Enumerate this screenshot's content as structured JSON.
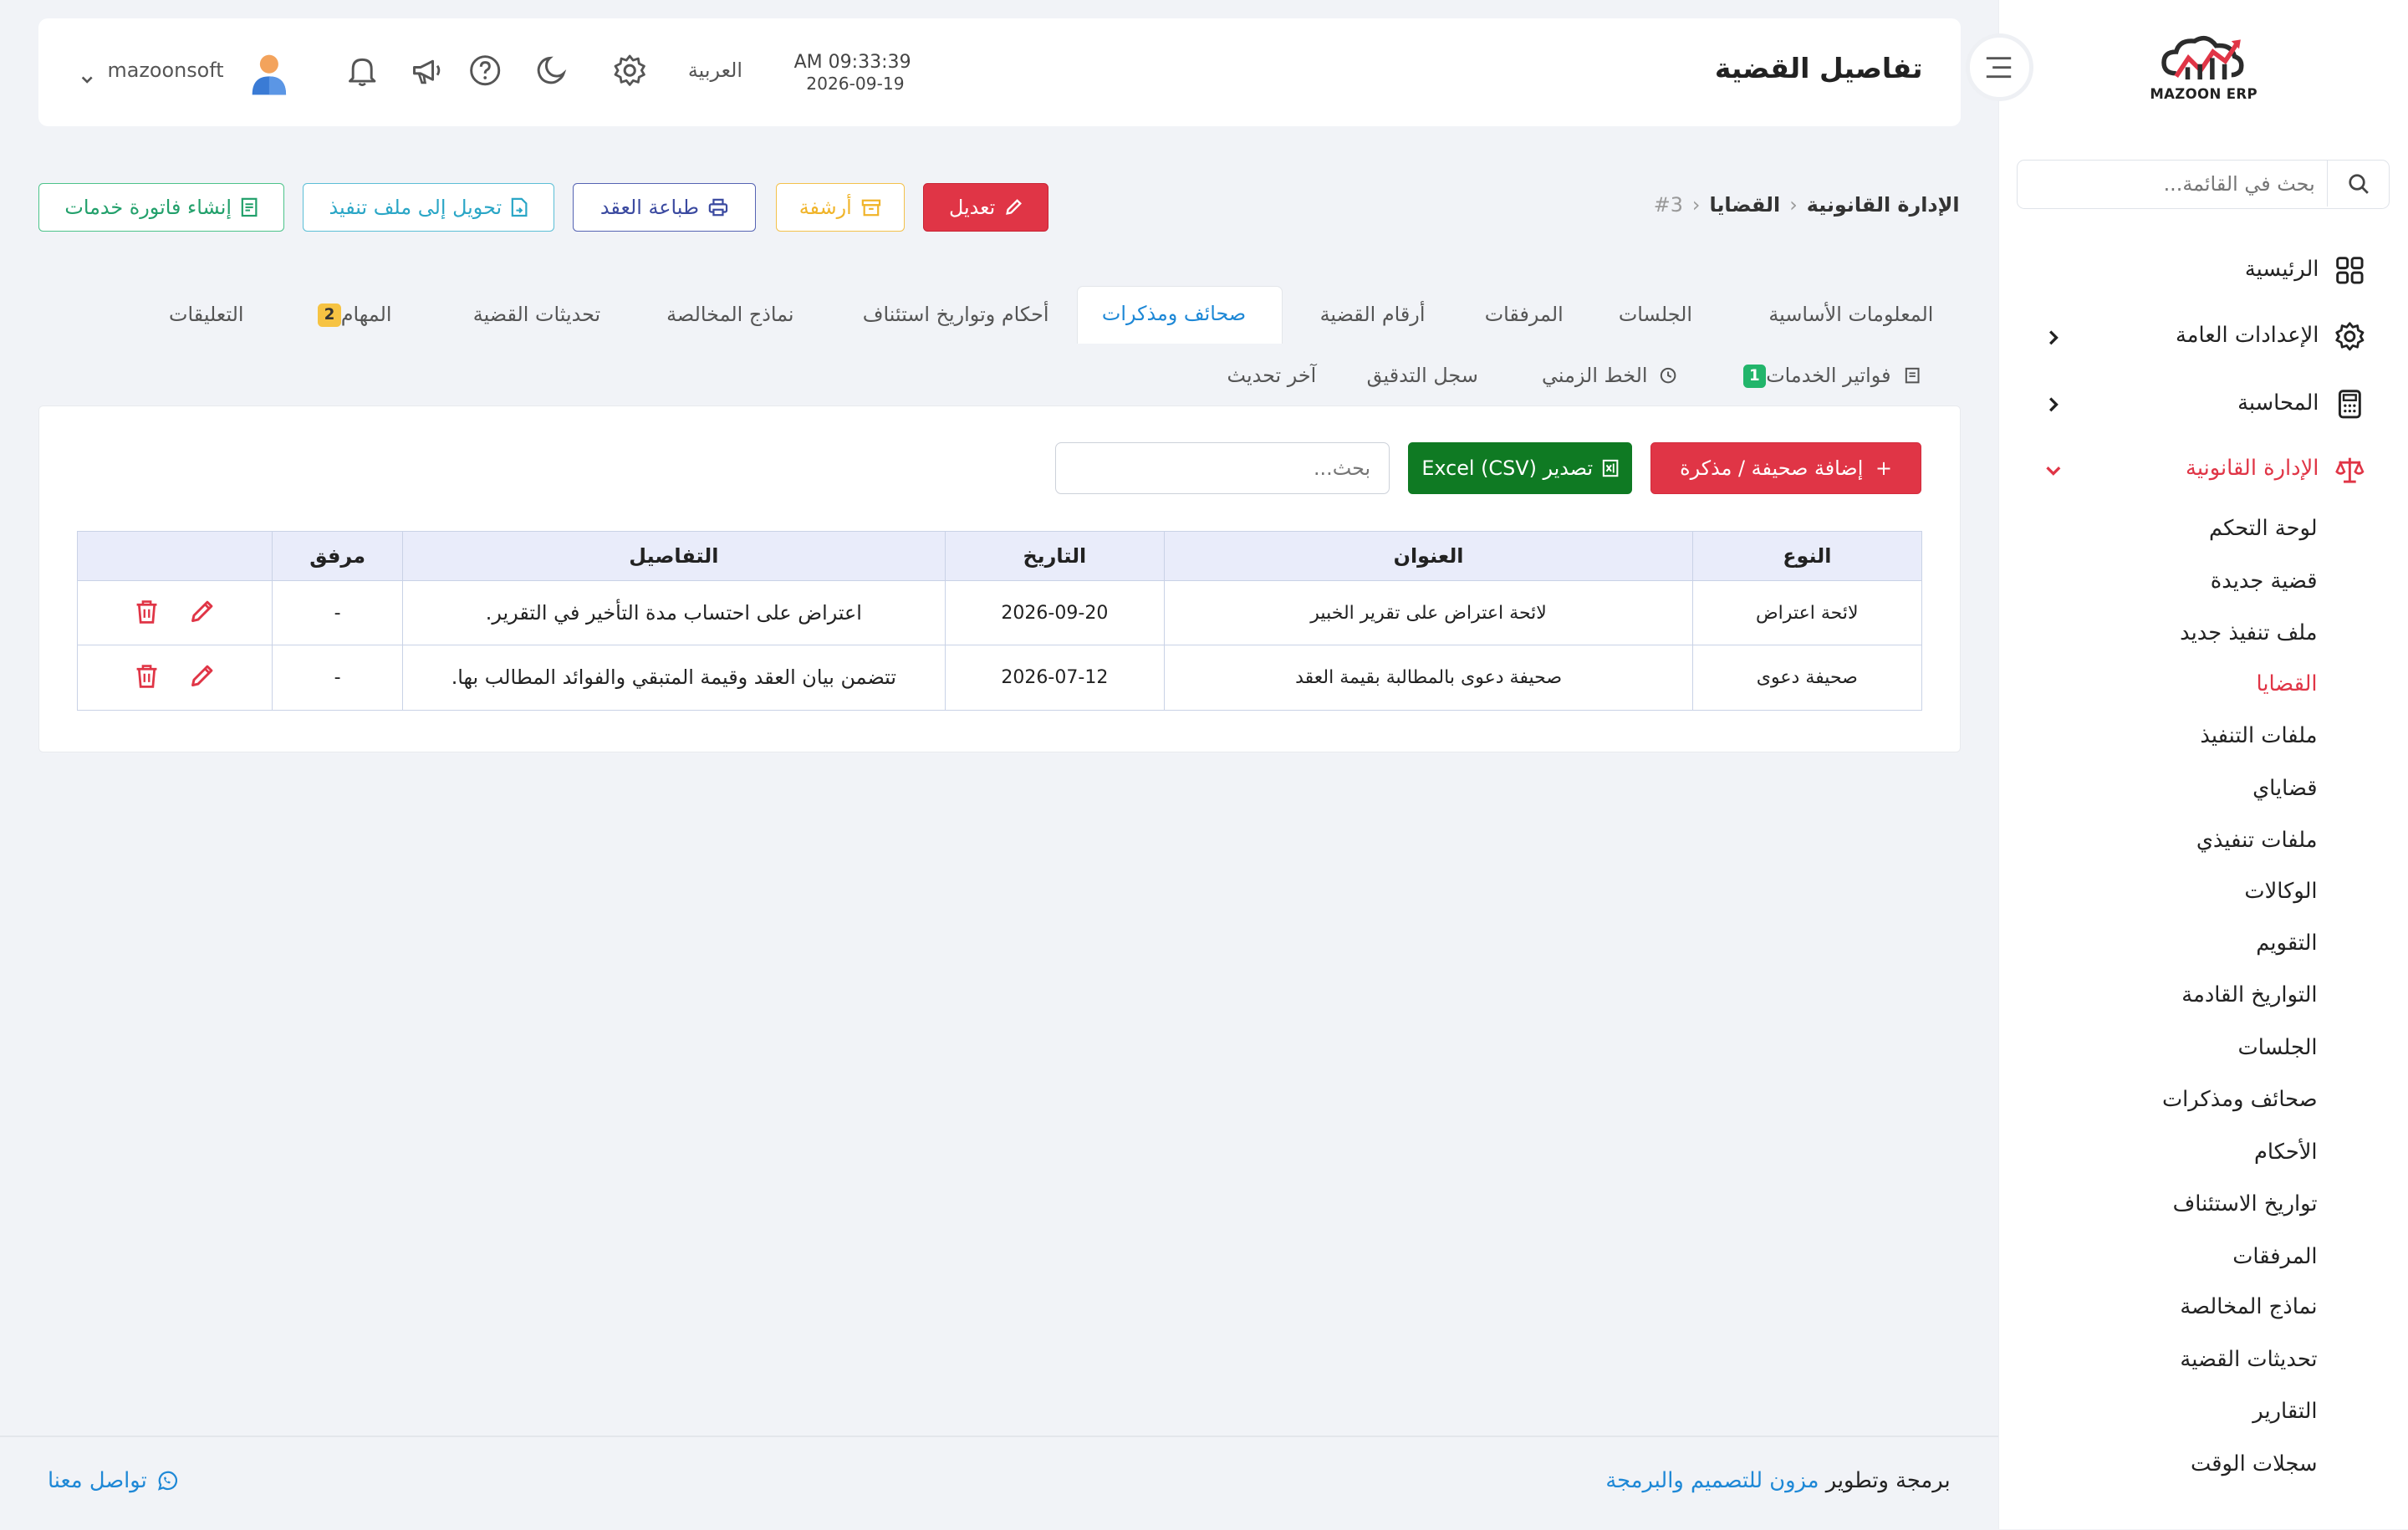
{
  "brand": {
    "logo_text": "MAZOON ERP",
    "logo_small": "ERP"
  },
  "sidebar": {
    "search_placeholder": "بحث في القائمة...",
    "items": [
      {
        "label": "الرئيسية",
        "icon": "grid-icon"
      },
      {
        "label": "الإعدادات العامة",
        "icon": "gear-icon"
      },
      {
        "label": "المحاسبة",
        "icon": "calculator-icon"
      },
      {
        "label": "الإدارة القانونية",
        "icon": "scale-icon"
      }
    ],
    "subitems": [
      "لوحة التحكم",
      "قضية جديدة",
      "ملف تنفيذ جديد",
      "القضايا",
      "ملفات التنفيذ",
      "قضاياي",
      "ملفات تنفيذي",
      "الوكالات",
      "التقويم",
      "التواريخ القادمة",
      "الجلسات",
      "صحائف ومذكرات",
      "الأحكام",
      "تواريخ الاستئناف",
      "المرفقات",
      "نماذج المخالصة",
      "تحديثات القضية",
      "التقارير",
      "سجلات الوقت"
    ]
  },
  "header": {
    "title": "تفاصيل القضية",
    "time": "AM 09:33:39",
    "date": "2026-09-19",
    "language": "العربية",
    "username": "mazoonsoft"
  },
  "breadcrumb": {
    "root": "الإدارة القانونية",
    "section": "القضايا",
    "id": "#3"
  },
  "actions": {
    "edit": "تعديل",
    "archive": "أرشفة",
    "print": "طباعة العقد",
    "convert": "تحويل إلى ملف تنفيذ",
    "invoice": "إنشاء فاتورة خدمات"
  },
  "tabs": {
    "basic": "المعلومات الأساسية",
    "sessions": "الجلسات",
    "attachments": "المرفقات",
    "case_numbers": "أرقام القضية",
    "pleadings": "صحائف ومذكرات",
    "rulings": "أحكام وتواريخ استئناف",
    "settlement": "نماذج المخالصة",
    "updates": "تحديثات القضية",
    "tasks": "المهام",
    "tasks_count": "2",
    "comments": "التعليقات",
    "invoices": "فواتير الخدمات",
    "invoices_count": "1",
    "timeline": "الخط الزمني",
    "audit": "سجل التدقيق",
    "last_update": "آخر تحديث"
  },
  "toolbar": {
    "add_label": "إضافة صحيفة / مذكرة",
    "export_label": "تصدير (CSV) Excel",
    "search_placeholder": "بحث..."
  },
  "table": {
    "headers": [
      "النوع",
      "العنوان",
      "التاريخ",
      "التفاصيل",
      "مرفق",
      ""
    ],
    "rows": [
      {
        "type": "لائحة اعتراض",
        "title": "لائحة اعتراض على تقرير الخبير",
        "date": "2026-09-20",
        "details": "اعتراض على احتساب مدة التأخير في التقرير.",
        "attachment": "-"
      },
      {
        "type": "صحيفة دعوى",
        "title": "صحيفة دعوى بالمطالبة بقيمة العقد",
        "date": "2026-07-12",
        "details": "تتضمن بيان العقد وقيمة المتبقي والفوائد المطالب بها.",
        "attachment": "-"
      }
    ]
  },
  "footer": {
    "credit_prefix": "برمجة وتطوير",
    "credit_link": "مزون للتصميم والبرمجة",
    "contact": "تواصل معنا"
  },
  "colors": {
    "accent": "#e03546",
    "link": "#1e88d6",
    "success": "#0f7a23"
  }
}
